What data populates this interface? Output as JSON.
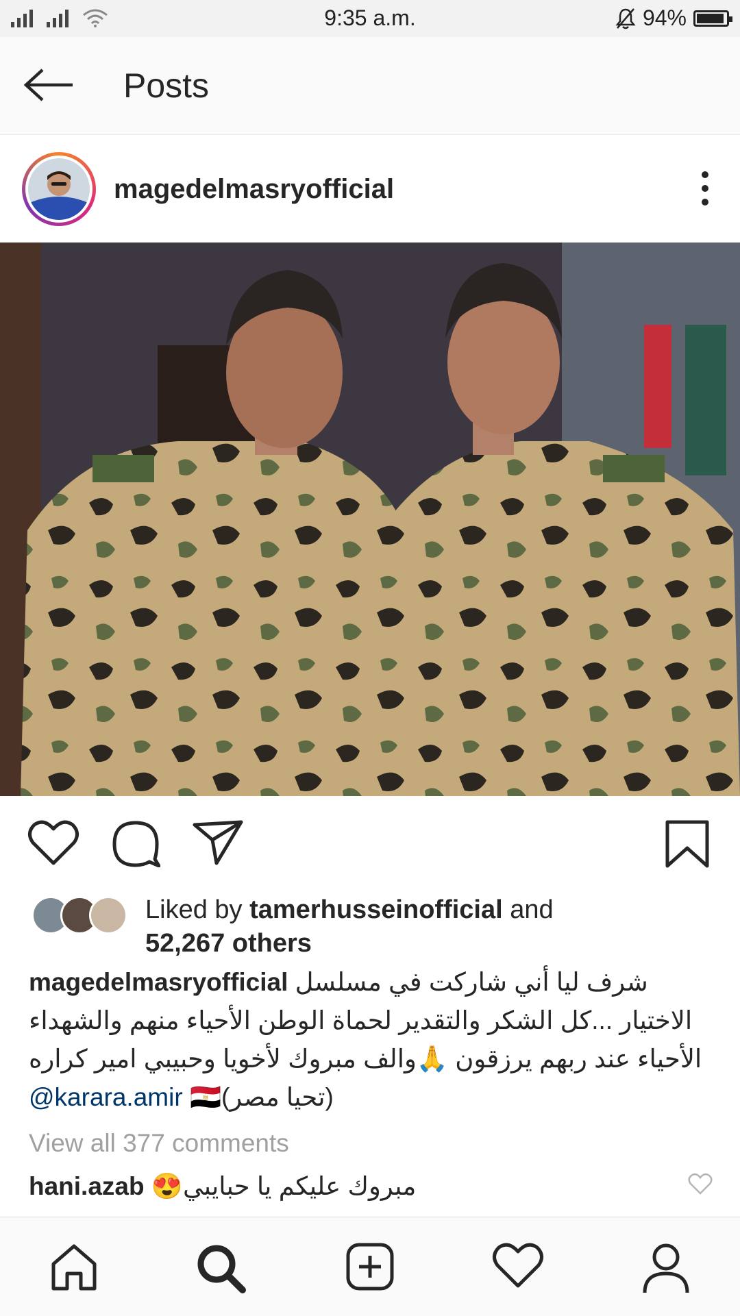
{
  "status_bar": {
    "time": "9:35 a.m.",
    "battery": "94%",
    "battery_level": 0.94,
    "icons": [
      "signal-icon",
      "signal-icon",
      "wifi-icon",
      "mute-bell-icon",
      "battery-icon"
    ]
  },
  "app_bar": {
    "back_icon": "arrow-left-icon",
    "title": "Posts"
  },
  "post": {
    "username": "magedelmasryofficial",
    "more_icon": "vertical-dots-icon",
    "actions": {
      "like_icon": "heart-icon",
      "comment_icon": "comment-bubble-icon",
      "share_icon": "paper-plane-icon",
      "save_icon": "bookmark-icon"
    },
    "likes": {
      "prefix": "Liked by",
      "liker": "tamerhusseinofficial",
      "connector": "and",
      "others": "52,267 others"
    },
    "caption": {
      "username": "magedelmasryofficial",
      "line1": "شرف ليا أني شاركت في مسلسل",
      "line2": "الاختيار ...كل الشكر والتقدير لحماة الوطن الأحياء منهم والشهداء",
      "line3": "الأحياء عند ربهم يرزقون 🙏والف مبروك لأخويا وحبيبي امير كراره",
      "mention": "@karara.amir",
      "line4_rest": "(تحيا مصر)🇪🇬"
    },
    "view_all_comments": "View all 377 comments",
    "top_comment": {
      "username": "hani.azab",
      "text": "مبروك عليكم يا حبايبي😍"
    }
  },
  "bottom_nav": {
    "items": [
      "home-icon",
      "search-icon",
      "add-post-icon",
      "activity-heart-icon",
      "profile-icon"
    ]
  },
  "colors": {
    "text": "#262626",
    "muted": "#a0a0a0",
    "mention": "#003569",
    "background": "#ffffff",
    "bar": "#fafafa"
  }
}
